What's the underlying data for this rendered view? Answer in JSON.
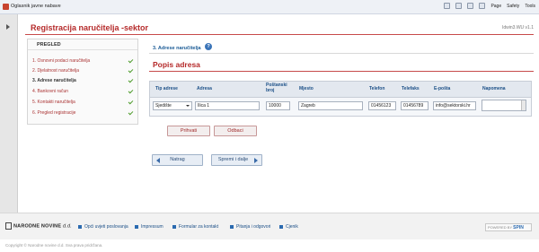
{
  "browser": {
    "tab_title": "Oglasnik javne nabave",
    "tools": [
      "Page",
      "Safety",
      "Tools"
    ]
  },
  "header": {
    "title": "Registracija naručitelja -sektor",
    "version": "Idwin3.WU v1.1"
  },
  "steps": {
    "heading": "PREGLED",
    "items": [
      {
        "label": "1. Osnovni podaci naručitelja",
        "done": true
      },
      {
        "label": "2. Djelatnost naručitelja",
        "done": true
      },
      {
        "label": "3. Adrese naručitelja",
        "done": true,
        "active": true
      },
      {
        "label": "4. Bankovni račun",
        "done": true
      },
      {
        "label": "5. Kontakti naručitelja",
        "done": true
      },
      {
        "label": "6. Pregled registracije",
        "done": true
      }
    ]
  },
  "breadcrumb": "3. Adrese naručitelja",
  "section_title": "Popis adresa",
  "table": {
    "headers": [
      "Tip adrese",
      "Adresa",
      "Poštanski broj",
      "Mjesto",
      "Telefon",
      "Telefaks",
      "E-pošta",
      "Napomena"
    ],
    "row": {
      "tip_adrese": "Sjedište",
      "adresa": "Ilica 1",
      "postanski_broj": "10000",
      "mjesto": "Zagreb",
      "telefon": "01456123",
      "telefaks": "01456789",
      "email": "info@sektorski.hr",
      "napomena": ""
    }
  },
  "buttons": {
    "accept": "Prihvati",
    "cancel": "Odbaci",
    "back": "Natrag",
    "next": "Spremi i dalje"
  },
  "footer": {
    "logo": "NARODNE NOVINE",
    "logo_suffix": "d.d.",
    "links": [
      "Opći uvjeti poslovanja",
      "Impressum",
      "Formular za kontakt",
      "Pitanja i odgovori",
      "Cjenik"
    ],
    "powered_label": "POWERED BY",
    "powered_brand": "SPIN",
    "copyright": "Copyright © Narodne novine d.d. Sva prava pridržana."
  },
  "colors": {
    "accent_red": "#b52a2a",
    "link_blue": "#1b4f87",
    "check_green": "#4d9b2a"
  }
}
